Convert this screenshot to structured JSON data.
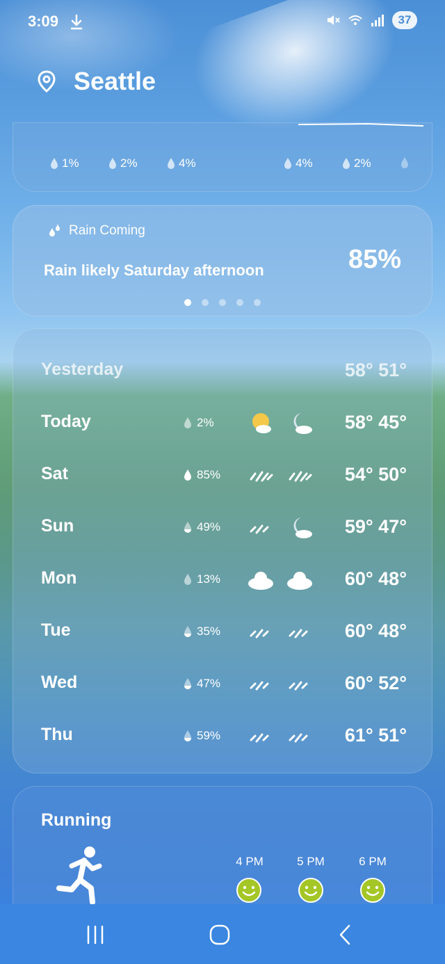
{
  "status_bar": {
    "time": "3:09",
    "battery": "37",
    "icons": [
      "download-icon",
      "mute-icon",
      "wifi-icon",
      "signal-icon"
    ]
  },
  "header": {
    "city": "Seattle"
  },
  "precip_strip": {
    "values": [
      "1%",
      "2%",
      "4%",
      "4%",
      "2%"
    ]
  },
  "rain_card": {
    "label": "Rain Coming",
    "text": "Rain likely Saturday afternoon",
    "percent": "85%",
    "page_count": 5,
    "active_page": 0
  },
  "forecast": [
    {
      "day": "Yesterday",
      "pop": "",
      "day_icon": "",
      "night_icon": "",
      "temps": "58°  51°"
    },
    {
      "day": "Today",
      "pop": "2%",
      "day_icon": "partly-sunny-icon",
      "night_icon": "partly-cloudy-night-icon",
      "temps": "58° 45°"
    },
    {
      "day": "Sat",
      "pop": "85%",
      "day_icon": "rain-icon",
      "night_icon": "rain-icon",
      "temps": "54° 50°"
    },
    {
      "day": "Sun",
      "pop": "49%",
      "day_icon": "showers-icon",
      "night_icon": "partly-cloudy-night-icon",
      "temps": "59° 47°"
    },
    {
      "day": "Mon",
      "pop": "13%",
      "day_icon": "cloudy-icon",
      "night_icon": "cloudy-icon",
      "temps": "60° 48°"
    },
    {
      "day": "Tue",
      "pop": "35%",
      "day_icon": "showers-icon",
      "night_icon": "showers-icon",
      "temps": "60° 48°"
    },
    {
      "day": "Wed",
      "pop": "47%",
      "day_icon": "showers-icon",
      "night_icon": "showers-icon",
      "temps": "60° 52°"
    },
    {
      "day": "Thu",
      "pop": "59%",
      "day_icon": "showers-icon",
      "night_icon": "showers-icon",
      "temps": "61°  51°"
    }
  ],
  "running": {
    "title": "Running",
    "hours": [
      "4 PM",
      "5 PM",
      "6 PM"
    ]
  },
  "colors": {
    "smiley": "#a4c626",
    "sun": "#f5c84a"
  }
}
